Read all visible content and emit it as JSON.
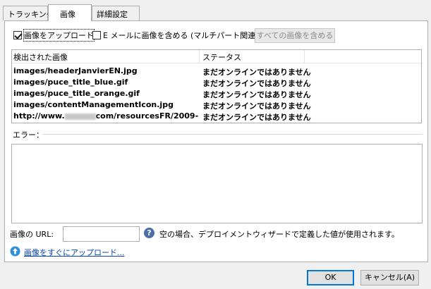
{
  "tabs": [
    {
      "label": "トラッキング"
    },
    {
      "label": "画像"
    },
    {
      "label": "詳細設定"
    }
  ],
  "options": {
    "upload_images_label": "画像をアップロード",
    "upload_images_checked": true,
    "include_images_label": "E メールに画像を含める (マルチパート関連)",
    "include_images_checked": false,
    "include_all_button": "すべての画像を含める"
  },
  "list": {
    "columns": [
      "検出された画像",
      "ステータス"
    ],
    "rows": [
      {
        "image": "images/headerJanvierEN.jpg",
        "status": "まだオンラインではありません"
      },
      {
        "image": "images/puce_title_blue.gif",
        "status": "まだオンラインではありません"
      },
      {
        "image": "images/puce_title_orange.gif",
        "status": "まだオンラインではありません"
      },
      {
        "image": "images/contentManagementIcon.jpg",
        "status": "まだオンラインではありません"
      },
      {
        "image_prefix": "http://www.",
        "image_suffix": "com/resourcesFR/2009-...",
        "status": "まだオンラインではありません"
      }
    ]
  },
  "errors": {
    "label": "エラー："
  },
  "url": {
    "label": "画像の URL:",
    "value": "",
    "help_icon": "question-icon",
    "hint": "空の場合、デプロイメントウィザードで定義した値が使用されます。"
  },
  "upload_link": {
    "icon": "upload-icon",
    "label": "画像をすぐにアップロード..."
  },
  "footer": {
    "ok": "OK",
    "cancel": "キャンセル(A)"
  }
}
